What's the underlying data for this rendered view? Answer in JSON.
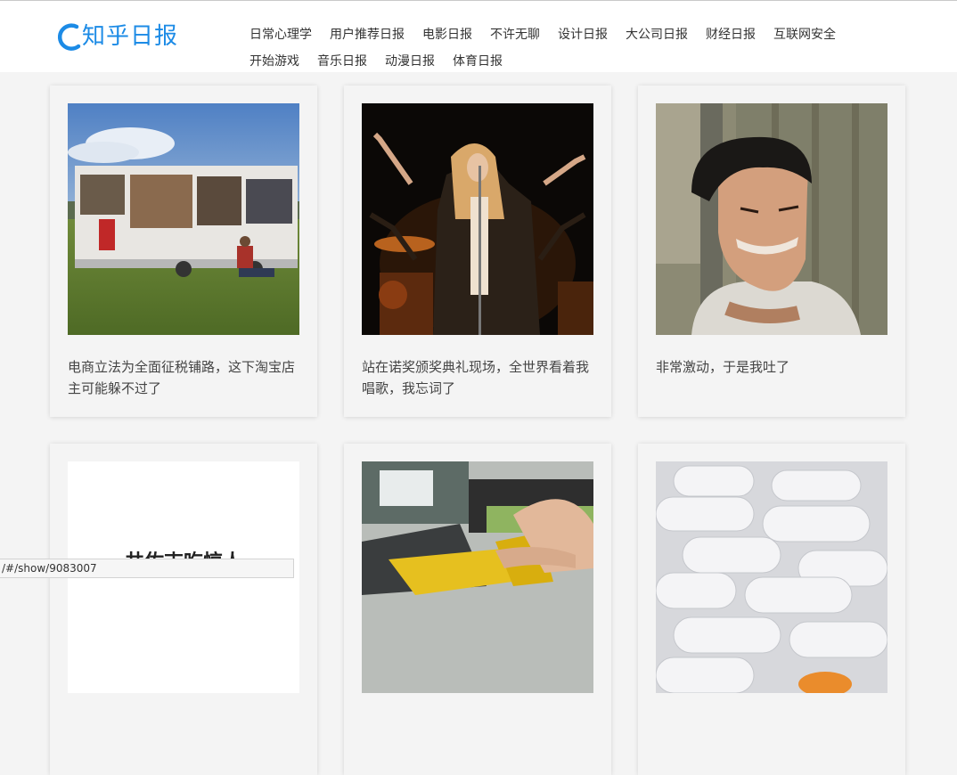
{
  "header": {
    "logo_text": "知乎日报",
    "accent_color": "#1c8be6",
    "nav_row1": [
      "日常心理学",
      "用户推荐日报",
      "电影日报",
      "不许无聊",
      "设计日报",
      "大公司日报",
      "财经日报",
      "互联网安全"
    ],
    "nav_row2": [
      "开始游戏",
      "音乐日报",
      "动漫日报",
      "体育日报"
    ]
  },
  "cards": [
    {
      "caption": "电商立法为全面征税铺路，这下淘宝店主可能躲不过了",
      "image": "food-truck-photo"
    },
    {
      "caption": "站在诺奖颁奖典礼现场，全世界看着我唱歌，我忘词了",
      "image": "singer-stage-photo"
    },
    {
      "caption": "非常激动，于是我吐了",
      "image": "man-grimace-photo"
    },
    {
      "caption": "",
      "image": "text-image",
      "image_text": "井佐吉吃惊人"
    },
    {
      "caption": "",
      "image": "fuel-pump-photo"
    },
    {
      "caption": "",
      "image": "pills-photo"
    }
  ],
  "status_bar": {
    "url": "/#/show/9083007"
  }
}
